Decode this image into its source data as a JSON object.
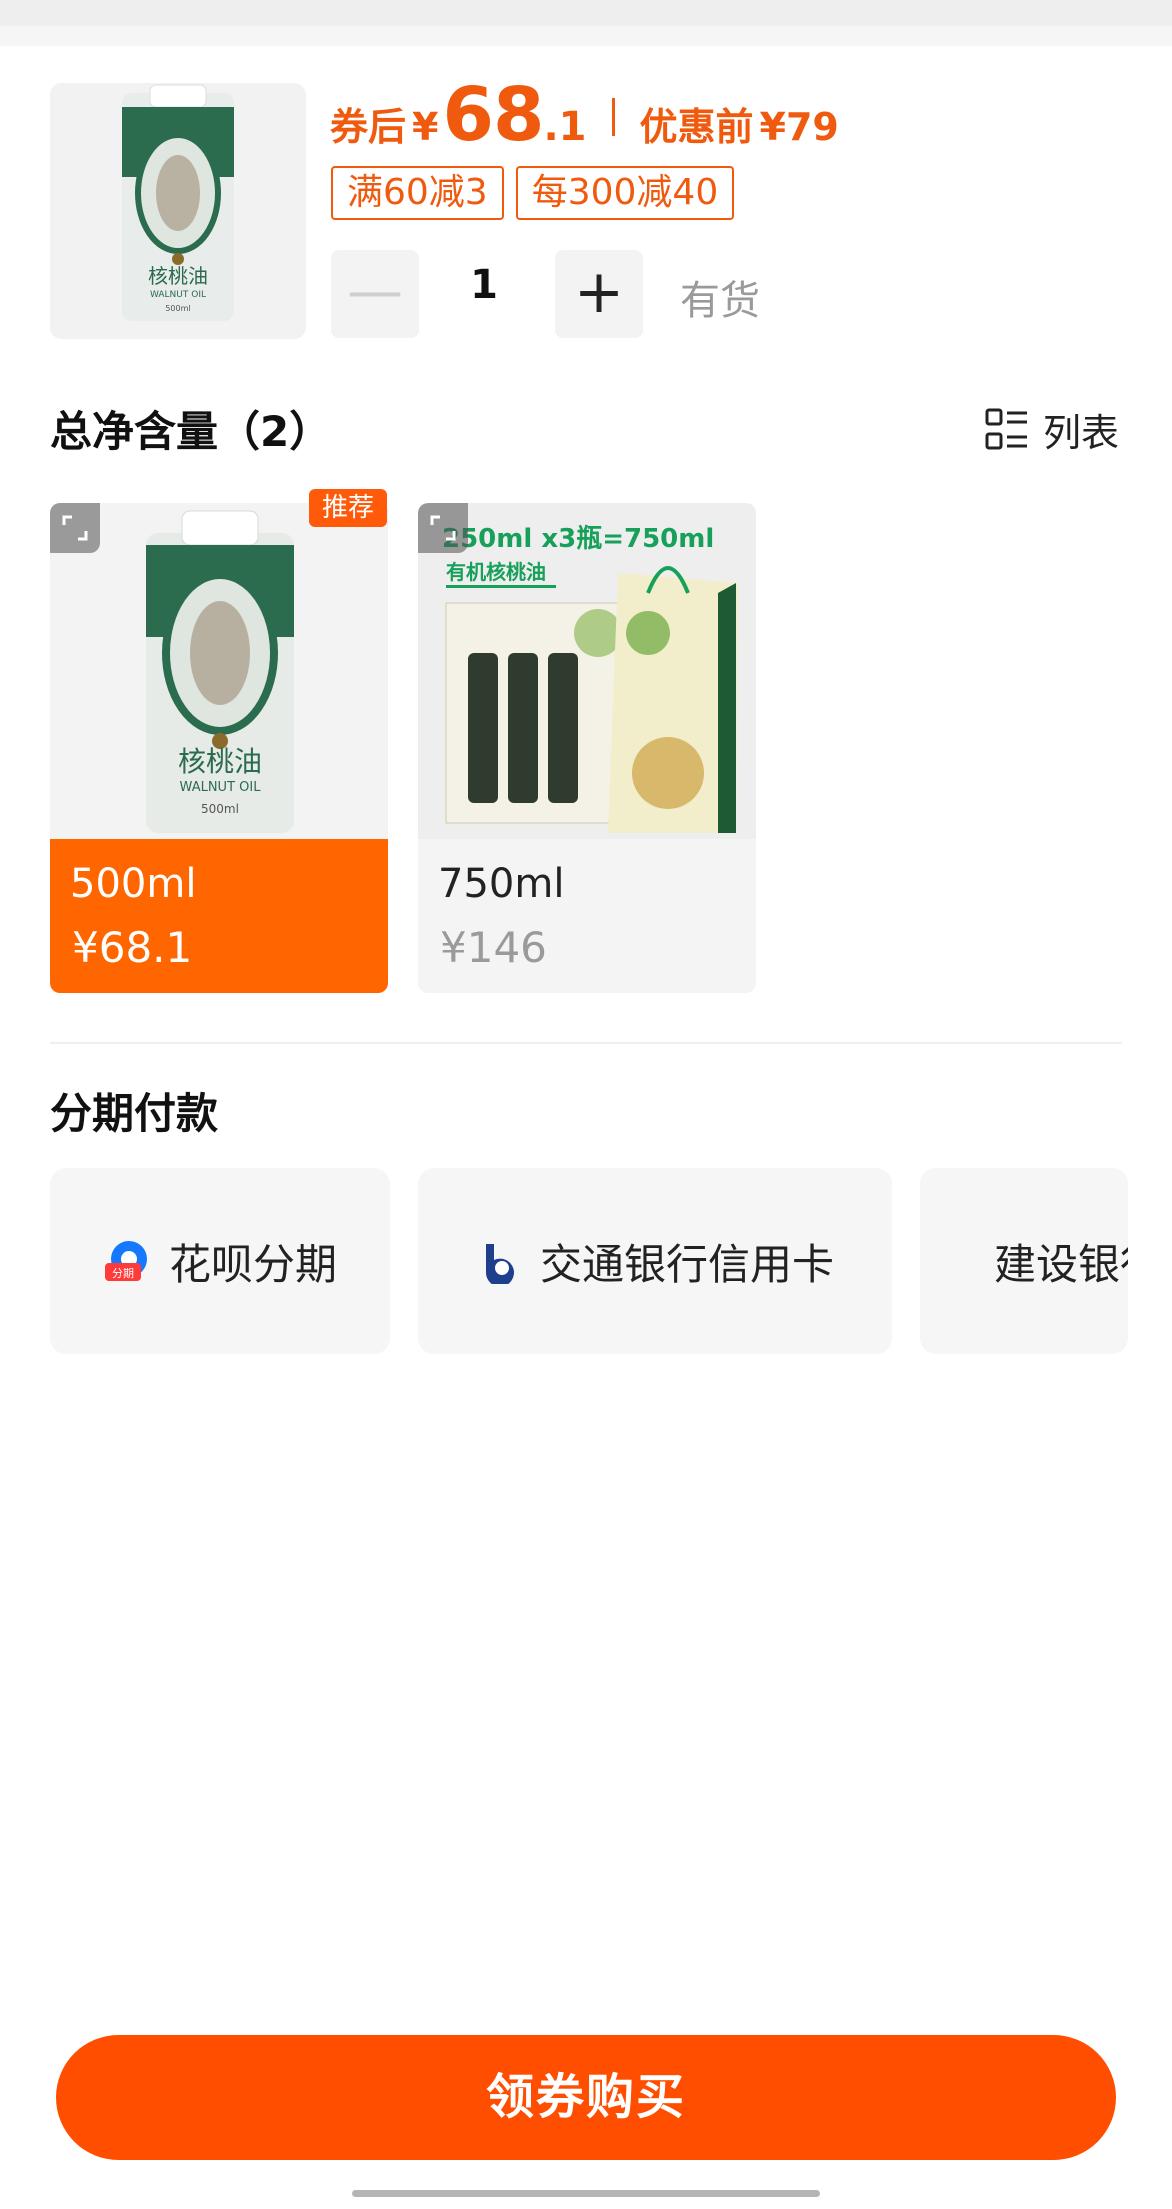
{
  "product": {
    "after_coupon_label": "券后",
    "currency": "¥",
    "price_int": "68",
    "price_dec": ".1",
    "before_label": "优惠前",
    "before_price": "¥79",
    "coupons": [
      "满60减3",
      "每300减40"
    ],
    "quantity": "1",
    "stock": "有货",
    "minus_symbol": "—",
    "plus_symbol": "+",
    "can_label_cn": "核桃油",
    "can_label_en": "WALNUT OIL",
    "can_volume": "500ml"
  },
  "spec": {
    "title": "总净含量（2）",
    "list_toggle_label": "列表",
    "options": [
      {
        "name": "500ml",
        "price": "¥68.1",
        "badge": "推荐",
        "selected": true
      },
      {
        "name": "750ml",
        "price": "¥146",
        "selected": false,
        "banner": "250ml x3瓶=750ml",
        "sub_banner": "有机核桃油"
      }
    ]
  },
  "installment": {
    "title": "分期付款",
    "options": [
      {
        "label": "花呗分期",
        "icon": "huabei-icon",
        "icon_badge": "分期"
      },
      {
        "label": "交通银行信用卡",
        "icon": "bocom-icon"
      },
      {
        "label": "建设银行信用卡",
        "icon": "ccb-icon"
      }
    ]
  },
  "cta": {
    "label": "领券购买"
  },
  "colors": {
    "accent": "#ff4e00",
    "price": "#f05a0e",
    "huabei": "#1677ff",
    "bocom": "#1d3f8c",
    "ccb": "#1a62c4"
  }
}
